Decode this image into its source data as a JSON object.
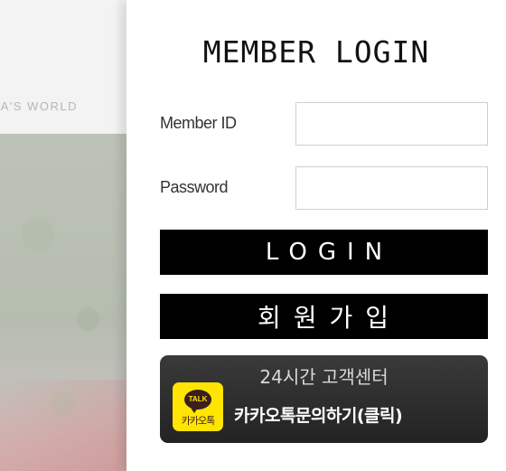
{
  "background": {
    "tagline": "LA'S WORLD"
  },
  "login": {
    "title": "MEMBER LOGIN",
    "id_label": "Member ID",
    "id_value": "",
    "password_label": "Password",
    "password_value": "",
    "login_button": "LOGIN",
    "join_button": "회원가입"
  },
  "kakao": {
    "logo_bubble": "TALK",
    "logo_brand": "카카오톡",
    "subtitle": "24시간 고객센터",
    "cta": "카카오톡문의하기(클릭)",
    "icon": "kakaotalk-icon",
    "colors": {
      "logo_bg": "#ffe500",
      "logo_text": "#3b1e1e",
      "panel_bg": "#2b2b2b"
    }
  }
}
